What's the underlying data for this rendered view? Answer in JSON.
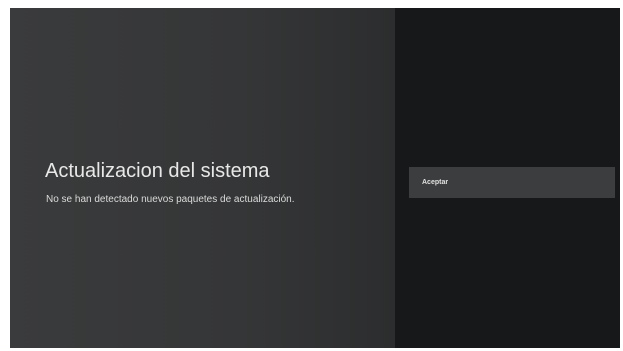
{
  "dialog": {
    "title": "Actualizacion del sistema",
    "message": "No se han detectado nuevos paquetes de actualización."
  },
  "actions": {
    "accept_label": "Aceptar"
  },
  "colors": {
    "left_panel": "#383939",
    "right_panel": "#17181a",
    "button_focus": "#3c3d3e",
    "text": "#e8e8e8"
  }
}
